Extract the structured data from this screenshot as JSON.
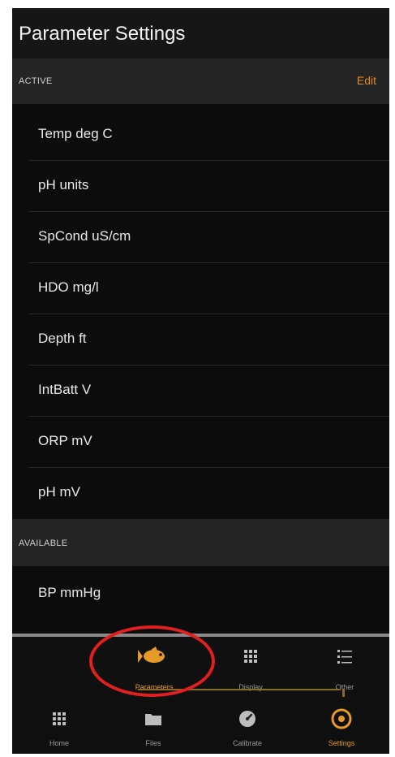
{
  "header": {
    "title": "Parameter Settings"
  },
  "active_section": {
    "label": "ACTIVE",
    "edit_label": "Edit"
  },
  "active_params": [
    {
      "label": "Temp deg C"
    },
    {
      "label": "pH units"
    },
    {
      "label": "SpCond uS/cm"
    },
    {
      "label": "HDO mg/l"
    },
    {
      "label": "Depth ft"
    },
    {
      "label": "IntBatt V"
    },
    {
      "label": "ORP mV"
    },
    {
      "label": "pH mV"
    }
  ],
  "available_section": {
    "label": "AVAILABLE"
  },
  "available_params": [
    {
      "label": "BP mmHg"
    }
  ],
  "sub_tabs": [
    {
      "label": "Parameters",
      "icon": "fish-icon",
      "active": true
    },
    {
      "label": "Display",
      "icon": "grid-icon",
      "active": false
    },
    {
      "label": "Other",
      "icon": "list-icon",
      "active": false
    }
  ],
  "main_tabs": [
    {
      "label": "Home",
      "icon": "grid-icon",
      "active": false
    },
    {
      "label": "Files",
      "icon": "folder-icon",
      "active": false
    },
    {
      "label": "Calibrate",
      "icon": "gauge-icon",
      "active": false
    },
    {
      "label": "Settings",
      "icon": "gear-icon",
      "active": true
    }
  ],
  "colors": {
    "accent": "#e59a2a",
    "background": "#0c0c0c",
    "section": "#242424",
    "annotation": "#e02020"
  }
}
